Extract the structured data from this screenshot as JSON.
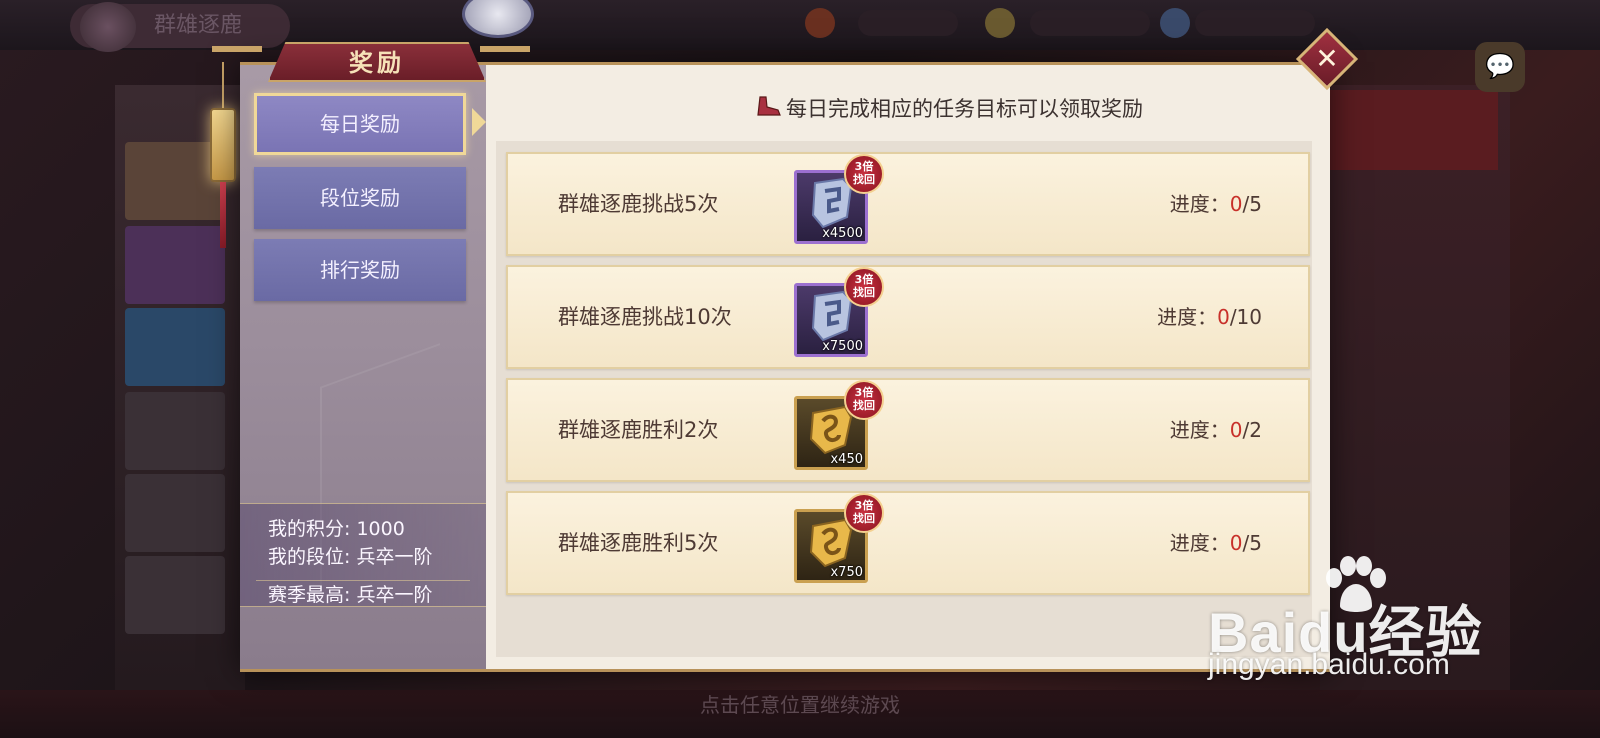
{
  "background": {
    "title": "群雄逐鹿",
    "hint": "点击任意位置继续游戏"
  },
  "modal": {
    "title": "奖励",
    "close_icon": "close-icon"
  },
  "tabs": [
    {
      "label": "每日奖励",
      "active": true
    },
    {
      "label": "段位奖励",
      "active": false
    },
    {
      "label": "排行奖励",
      "active": false
    }
  ],
  "stats": {
    "score_label": "我的积分",
    "score_value": "1000",
    "rank_label": "我的段位",
    "rank_value": "兵卒一阶",
    "season_best_label": "赛季最高",
    "season_best_value": "兵卒一阶"
  },
  "description": "每日完成相应的任务目标可以领取奖励",
  "tasks": [
    {
      "name": "群雄逐鹿挑战5次",
      "reward_icon": "silver-shield-icon",
      "reward_qty": "x4500",
      "bonus_top": "3倍",
      "bonus_bottom": "找回",
      "progress_label": "进度：",
      "progress_current": "0",
      "progress_total": "/5"
    },
    {
      "name": "群雄逐鹿挑战10次",
      "reward_icon": "silver-shield-icon",
      "reward_qty": "x7500",
      "bonus_top": "3倍",
      "bonus_bottom": "找回",
      "progress_label": "进度：",
      "progress_current": "0",
      "progress_total": "/10"
    },
    {
      "name": "群雄逐鹿胜利2次",
      "reward_icon": "gold-shield-icon",
      "reward_qty": "x450",
      "bonus_top": "3倍",
      "bonus_bottom": "找回",
      "progress_label": "进度：",
      "progress_current": "0",
      "progress_total": "/2"
    },
    {
      "name": "群雄逐鹿胜利5次",
      "reward_icon": "gold-shield-icon",
      "reward_qty": "x750",
      "bonus_top": "3倍",
      "bonus_bottom": "找回",
      "progress_label": "进度：",
      "progress_current": "0",
      "progress_total": "/5"
    }
  ],
  "watermark": {
    "logo": "Baidu经验",
    "url": "jingyan.baidu.com"
  },
  "colors": {
    "accent_gold": "#c9a468",
    "title_red": "#8a2f3a",
    "tab_purple": "#7c7cb4",
    "progress_red": "#c8302a"
  }
}
